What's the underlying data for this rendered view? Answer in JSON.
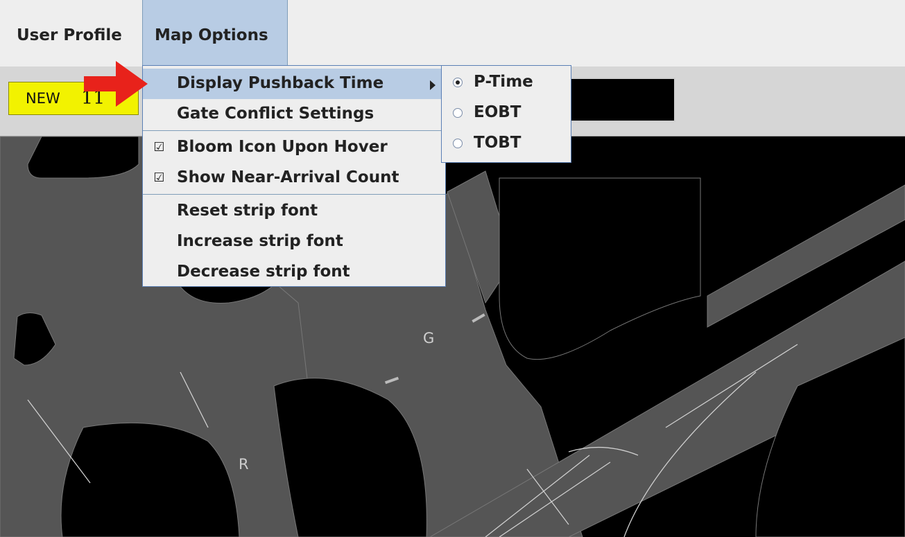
{
  "menubar": {
    "user_profile": "User Profile",
    "map_options": "Map Options"
  },
  "toolbar": {
    "new_label": "NEW",
    "new_count": "11"
  },
  "map_options_menu": {
    "items": [
      {
        "label": "Display Pushback Time",
        "highlighted": true,
        "has_submenu": true
      },
      {
        "label": "Gate Conflict Settings"
      },
      {
        "label": "Bloom Icon Upon Hover",
        "checked": true
      },
      {
        "label": "Show Near-Arrival Count",
        "checked": true
      },
      {
        "label": "Reset strip font"
      },
      {
        "label": "Increase strip font"
      },
      {
        "label": "Decrease strip font"
      }
    ]
  },
  "pushback_submenu": {
    "options": [
      {
        "label": "P-Time",
        "selected": true
      },
      {
        "label": "EOBT",
        "selected": false
      },
      {
        "label": "TOBT",
        "selected": false
      }
    ]
  },
  "map": {
    "labels": {
      "taxiway_g": "G",
      "taxiway_r": "R"
    }
  },
  "icons": {
    "check": "checkmark-icon",
    "submenu": "chevron-right-icon",
    "pointer": "red-arrow-icon"
  },
  "colors": {
    "menu_highlight": "#b8cce4",
    "new_badge": "#f2f200",
    "map_pavement": "#555555",
    "map_background": "#000000",
    "pointer_red": "#e8221b"
  }
}
